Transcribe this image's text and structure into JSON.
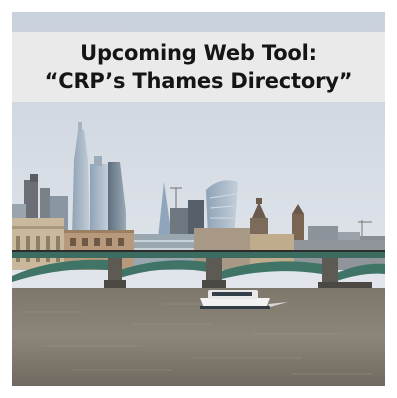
{
  "banner": {
    "line1": "Upcoming Web Tool:",
    "line2": "“CRP’s Thames Directory”"
  },
  "colors": {
    "sky": "#d7dde6",
    "water": "#8a8378",
    "bridge": "#3c6b5f",
    "banner_bg": "#ececec",
    "banner_text": "#151515"
  }
}
